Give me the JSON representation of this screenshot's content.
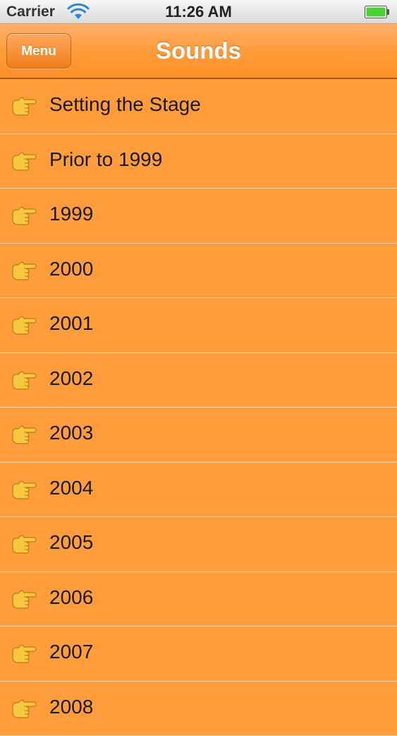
{
  "status_bar": {
    "carrier": "Carrier",
    "time": "11:26 AM",
    "battery_color": "#4cd137"
  },
  "nav_bar": {
    "menu_label": "Menu",
    "title": "Sounds"
  },
  "list": {
    "items": [
      {
        "label": "Setting the Stage",
        "icon": "pointing-hand-icon"
      },
      {
        "label": "Prior to 1999",
        "icon": "pointing-hand-icon"
      },
      {
        "label": "1999",
        "icon": "pointing-hand-icon"
      },
      {
        "label": "2000",
        "icon": "pointing-hand-icon"
      },
      {
        "label": "2001",
        "icon": "pointing-hand-icon"
      },
      {
        "label": "2002",
        "icon": "pointing-hand-icon"
      },
      {
        "label": "2003",
        "icon": "pointing-hand-icon"
      },
      {
        "label": "2004",
        "icon": "pointing-hand-icon"
      },
      {
        "label": "2005",
        "icon": "pointing-hand-icon"
      },
      {
        "label": "2006",
        "icon": "pointing-hand-icon"
      },
      {
        "label": "2007",
        "icon": "pointing-hand-icon"
      },
      {
        "label": "2008",
        "icon": "pointing-hand-icon"
      }
    ]
  },
  "colors": {
    "background": "#ff9c3c",
    "separator": "#fbd6b2",
    "nav_title": "#ffffff"
  }
}
